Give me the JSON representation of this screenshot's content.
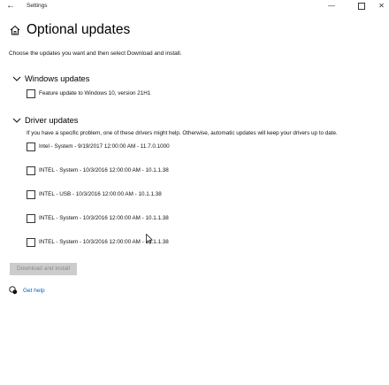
{
  "titlebar": {
    "app_title": "Settings",
    "back_icon": "back-arrow-icon",
    "minimize_icon": "minimize-icon",
    "maximize_icon": "maximize-icon",
    "close_icon": "close-icon"
  },
  "header": {
    "title": "Optional updates",
    "icon": "home-icon"
  },
  "intro_text": "Choose the updates you want and then select Download and install.",
  "windows_updates": {
    "title": "Windows updates",
    "items": [
      {
        "label": "Feature update to Windows 10, version 21H1",
        "checked": false
      }
    ]
  },
  "driver_updates": {
    "title": "Driver updates",
    "description": "If you have a specific problem, one of these drivers might help. Otherwise, automatic updates will keep your drivers up to date.",
    "items": [
      {
        "label": "Intel - System - 9/19/2017 12:00:00 AM - 11.7.0.1000",
        "checked": false
      },
      {
        "label": "INTEL - System - 10/3/2016 12:00:00 AM - 10.1.1.38",
        "checked": false
      },
      {
        "label": "INTEL - USB - 10/3/2016 12:00:00 AM - 10.1.1.38",
        "checked": false
      },
      {
        "label": "INTEL - System - 10/3/2016 12:00:00 AM - 10.1.1.38",
        "checked": false
      },
      {
        "label": "INTEL - System - 10/3/2016 12:00:00 AM - 10.1.1.38",
        "checked": false
      }
    ]
  },
  "download_button": {
    "label": "Download and install",
    "enabled": false
  },
  "help": {
    "label": "Get help",
    "icon": "help-chat-icon"
  },
  "colors": {
    "accent": "#0067c0",
    "disabled_button_bg": "#cccccc",
    "disabled_button_text": "#8a8a8a"
  }
}
